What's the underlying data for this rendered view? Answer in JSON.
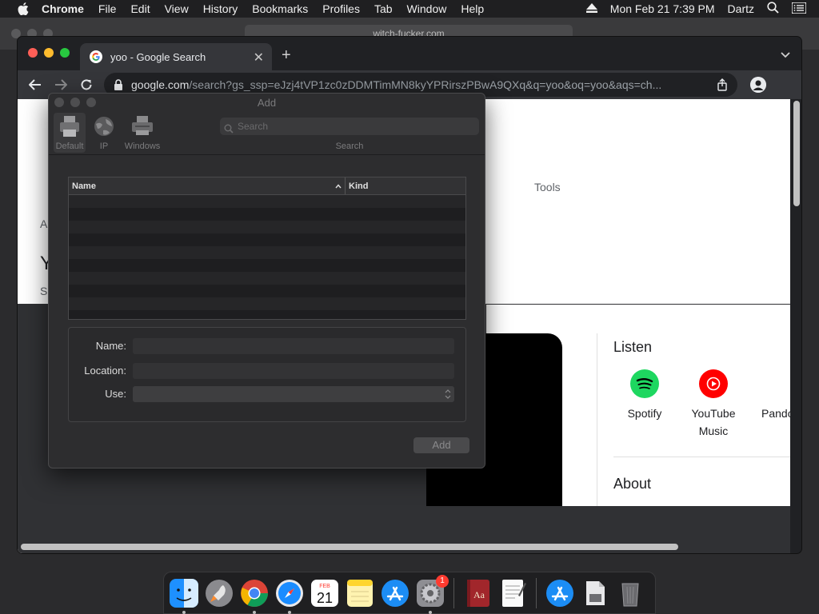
{
  "menubar": {
    "app": "Chrome",
    "items": [
      "File",
      "Edit",
      "View",
      "History",
      "Bookmarks",
      "Profiles",
      "Tab",
      "Window",
      "Help"
    ],
    "clock": "Mon Feb 21  7:39 PM",
    "user": "Dartz"
  },
  "background_window": {
    "address": "witch-fucker.com"
  },
  "chrome": {
    "tab_title": "yoo - Google Search",
    "url_host": "google.com",
    "url_path": "/search?gs_ssp=eJzj4tVP1zc0zDDMTimMN8kyYPRirszPBwA9QXq&q=yoo&oq=yoo&aqs=ch..."
  },
  "page": {
    "tools": "Tools",
    "listen_heading": "Listen",
    "services": [
      {
        "label": "Spotify",
        "color": "#1ed760"
      },
      {
        "label": "YouTube Music",
        "color": "#ff0000"
      },
      {
        "label": "Pando",
        "color": "#3668ff"
      }
    ],
    "about_heading": "About",
    "left_fragments": [
      "A",
      "Y",
      "S"
    ]
  },
  "dialog": {
    "title": "Add",
    "toolbar": [
      {
        "label": "Default",
        "icon": "printer-icon",
        "selected": true
      },
      {
        "label": "IP",
        "icon": "globe-icon",
        "selected": false
      },
      {
        "label": "Windows",
        "icon": "printer-icon",
        "selected": false
      }
    ],
    "search_placeholder": "Search",
    "search_label": "Search",
    "table": {
      "col_name": "Name",
      "col_kind": "Kind"
    },
    "form": {
      "name_label": "Name:",
      "location_label": "Location:",
      "use_label": "Use:"
    },
    "add_button": "Add"
  },
  "dock": {
    "apps": [
      "finder-icon",
      "launchpad-icon",
      "chrome-icon",
      "safari-icon",
      "calendar-icon",
      "notes-icon",
      "app-store-icon",
      "system-preferences-icon",
      "dictionary-icon",
      "textedit-icon",
      "app-store-icon",
      "file-icon",
      "trash-icon"
    ],
    "calendar_month": "FEB",
    "calendar_day": "21",
    "sysprefs_badge": "1"
  }
}
